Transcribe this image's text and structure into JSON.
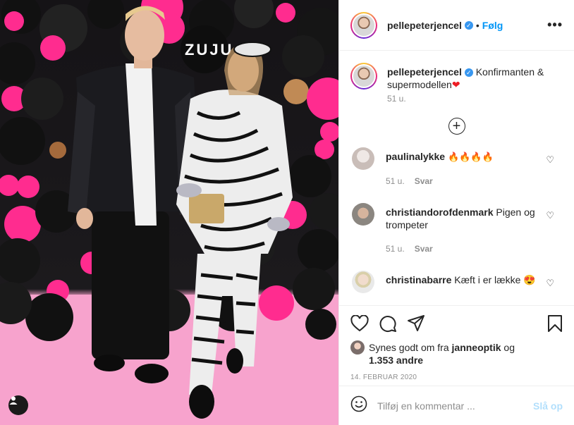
{
  "post": {
    "username": "pellepeterjencel",
    "follow_label": "Følg",
    "caption_text": "Konfirmanten & supermodellen",
    "caption_emoji": "❤",
    "caption_time": "51 u.",
    "sign_text": "ZUJU"
  },
  "comments": [
    {
      "username": "paulinalykke",
      "text": "🔥🔥🔥🔥",
      "time": "51 u.",
      "reply": "Svar"
    },
    {
      "username": "christiandorofdenmark",
      "text": "Pigen og trompeter",
      "time": "51 u.",
      "reply": "Svar"
    },
    {
      "username": "christinabarre",
      "text": "Kæft i er lække 😍"
    }
  ],
  "likes": {
    "prefix": "Synes godt om fra",
    "user": "janneoptik",
    "joiner": "og",
    "count": "1.353 andre"
  },
  "date": "14. FEBRUAR 2020",
  "add_comment": {
    "placeholder": "Tilføj en kommentar ...",
    "post_label": "Slå op"
  },
  "icons": [
    "user-tag-icon",
    "more-options-icon",
    "verified-icon",
    "load-more-icon",
    "heart-icon",
    "comment-icon",
    "share-icon",
    "save-icon",
    "emoji-icon"
  ],
  "colors": {
    "accent": "#0095f6",
    "verified": "#3897f0",
    "post_disabled": "#b2dffc",
    "magenta": "#ff2c8f"
  }
}
